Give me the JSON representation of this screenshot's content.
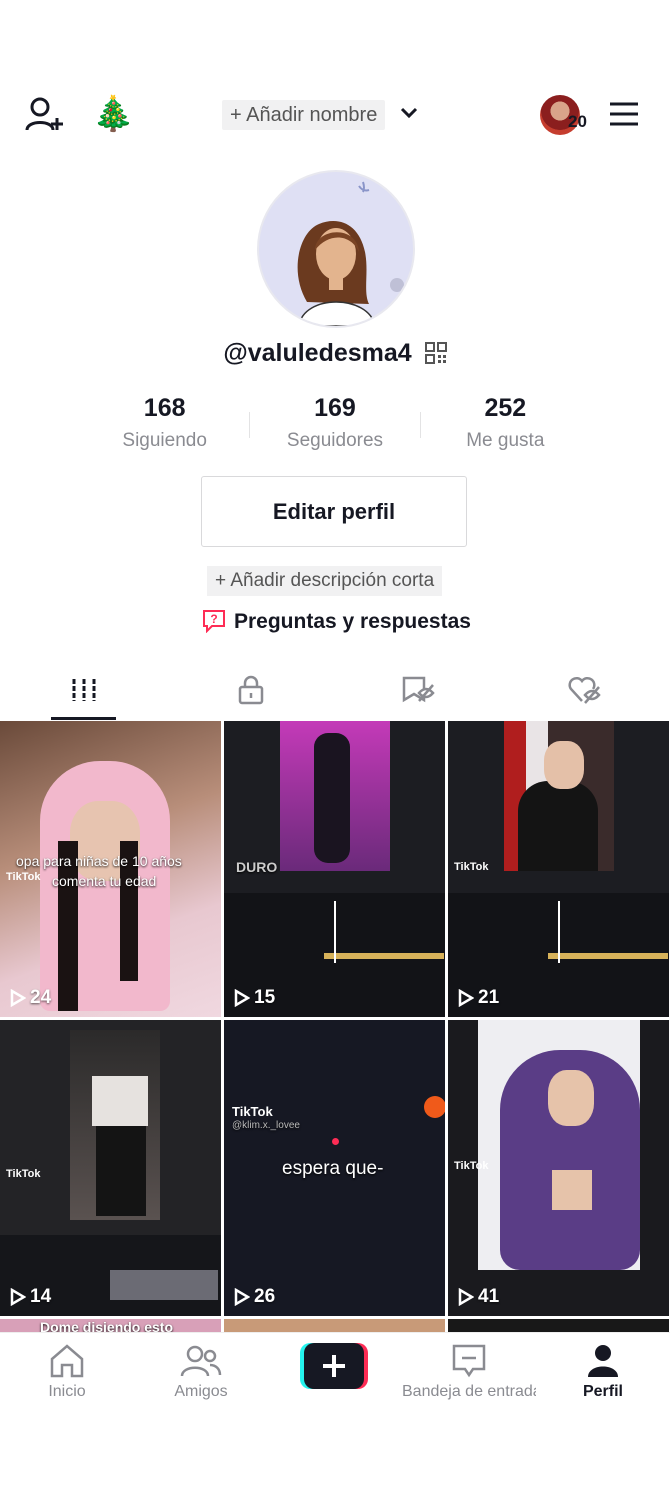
{
  "header": {
    "add_name": "+ Añadir nombre",
    "story_count": "20"
  },
  "profile": {
    "username": "@valuledesma4",
    "stats": [
      {
        "value": "168",
        "label": "Siguiendo"
      },
      {
        "value": "169",
        "label": "Seguidores"
      },
      {
        "value": "252",
        "label": "Me gusta"
      }
    ],
    "edit_button": "Editar perfil",
    "add_description": "+ Añadir descripción corta",
    "qa_label": "Preguntas y respuestas"
  },
  "tabs": [
    "videos-icon",
    "lock-icon",
    "saved-icon",
    "liked-icon"
  ],
  "videos": [
    {
      "views": "24",
      "caption1": "opa para niñas de 10 años",
      "caption2": "comenta tu edad",
      "watermark": "TikTok"
    },
    {
      "views": "15",
      "caption1": "DURO",
      "caption2": "",
      "watermark": ""
    },
    {
      "views": "21",
      "caption1": "",
      "caption2": "",
      "watermark": "TikTok"
    },
    {
      "views": "14",
      "caption1": "",
      "caption2": "",
      "watermark": "TikTok"
    },
    {
      "views": "26",
      "caption1": "espera que-",
      "caption2": "@klim.x._lovee",
      "watermark": "TikTok"
    },
    {
      "views": "41",
      "caption1": "",
      "caption2": "",
      "watermark": "TikTok"
    }
  ],
  "partial_caption": "Dome disiendo esto",
  "nav": [
    {
      "label": "Inicio",
      "icon": "home-icon"
    },
    {
      "label": "Amigos",
      "icon": "friends-icon"
    },
    {
      "label": "",
      "icon": "plus-icon"
    },
    {
      "label": "Bandeja de entrada",
      "icon": "inbox-icon"
    },
    {
      "label": "Perfil",
      "icon": "profile-icon"
    }
  ],
  "colors": {
    "accent_cyan": "#25f4ee",
    "accent_red": "#fe2c55",
    "text": "#161823",
    "muted": "#8a8b91"
  }
}
